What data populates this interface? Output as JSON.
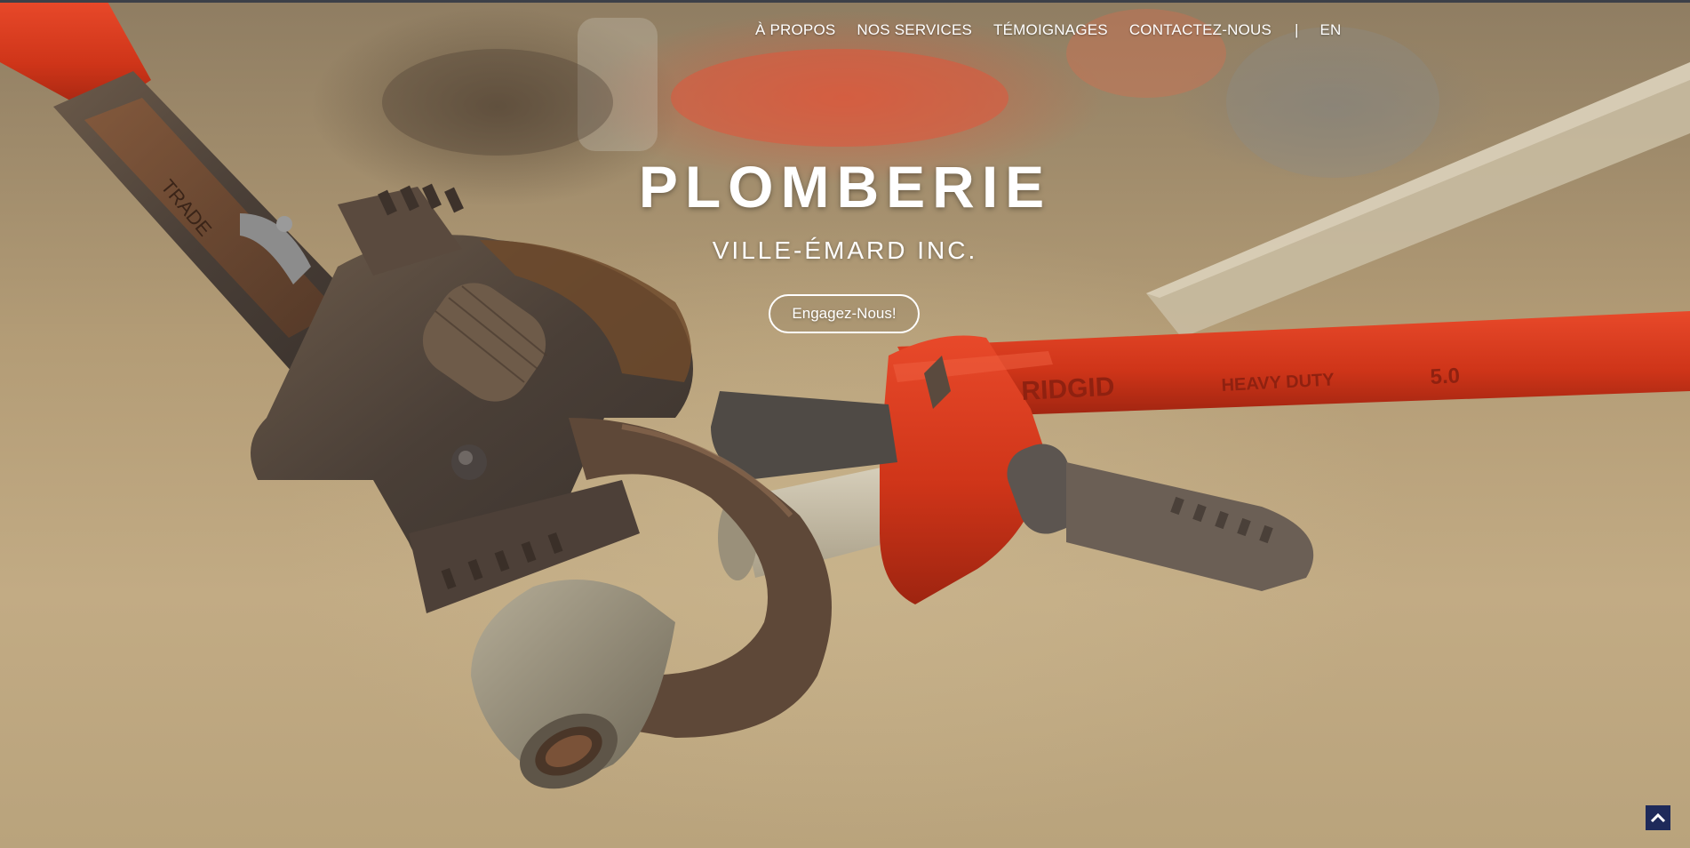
{
  "nav": {
    "items": [
      {
        "label": "À PROPOS"
      },
      {
        "label": "NOS SERVICES"
      },
      {
        "label": "TÉMOIGNAGES"
      },
      {
        "label": "CONTACTEZ-NOUS"
      }
    ],
    "separator": "|",
    "lang": "EN"
  },
  "hero": {
    "title": "PLOMBERIE",
    "subtitle": "VILLE-ÉMARD INC.",
    "cta": "Engagez-Nous!"
  },
  "icons": {
    "back_to_top": "chevron-up-icon"
  },
  "colors": {
    "wrench_red": "#d7391f",
    "back_to_top_bg": "#1e2a5a"
  }
}
